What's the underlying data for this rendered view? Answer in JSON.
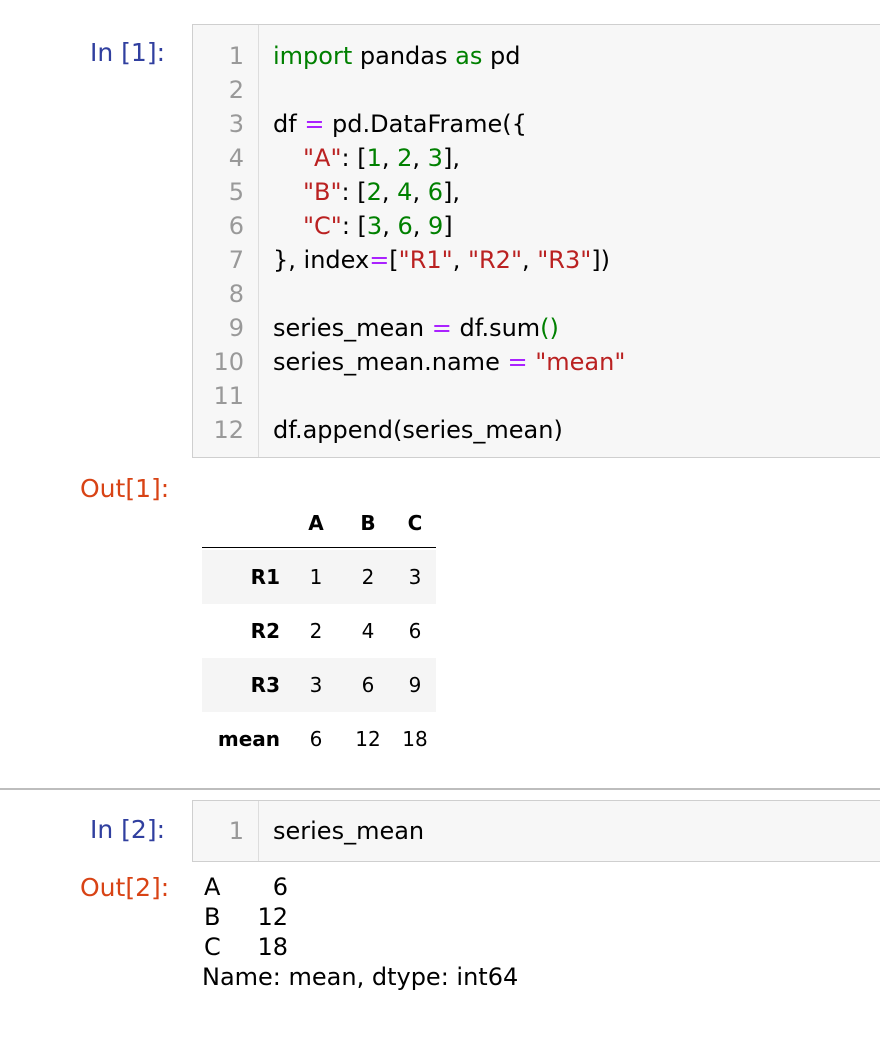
{
  "cells": [
    {
      "in_prompt": "In [1]:",
      "out_prompt": "Out[1]:",
      "line_numbers": [
        "1",
        "2",
        "3",
        "4",
        "5",
        "6",
        "7",
        "8",
        "9",
        "10",
        "11",
        "12"
      ],
      "code": {
        "l1": {
          "kw": "import",
          "a": " pandas ",
          "kw2": "as",
          "b": " pd"
        },
        "l3": {
          "a": "df ",
          "op": "=",
          "b": " pd.DataFrame({"
        },
        "l4": {
          "s": "\"A\"",
          "a": ": [",
          "n1": "1",
          "c1": ", ",
          "n2": "2",
          "c2": ", ",
          "n3": "3",
          "b": "],"
        },
        "l5": {
          "s": "\"B\"",
          "a": ": [",
          "n1": "2",
          "c1": ", ",
          "n2": "4",
          "c2": ", ",
          "n3": "6",
          "b": "],"
        },
        "l6": {
          "s": "\"C\"",
          "a": ": [",
          "n1": "3",
          "c1": ", ",
          "n2": "6",
          "c2": ", ",
          "n3": "9",
          "b": "]"
        },
        "l7": {
          "a": "}, index",
          "op": "=",
          "b": "[",
          "s1": "\"R1\"",
          "c1": ", ",
          "s2": "\"R2\"",
          "c2": ", ",
          "s3": "\"R3\"",
          "c": "])"
        },
        "l9": {
          "a": "series_mean ",
          "op": "=",
          "b": " df.sum",
          "op2": "()"
        },
        "l10": {
          "a": "series_mean.name ",
          "op": "=",
          "b": " ",
          "s": "\"mean\""
        },
        "l12": {
          "a": "df.append(series_mean)"
        }
      },
      "output_table": {
        "columns": [
          "A",
          "B",
          "C"
        ],
        "rows": [
          {
            "index": "R1",
            "values": [
              "1",
              "2",
              "3"
            ]
          },
          {
            "index": "R2",
            "values": [
              "2",
              "4",
              "6"
            ]
          },
          {
            "index": "R3",
            "values": [
              "3",
              "6",
              "9"
            ]
          },
          {
            "index": "mean",
            "values": [
              "6",
              "12",
              "18"
            ]
          }
        ]
      }
    },
    {
      "in_prompt": "In [2]:",
      "out_prompt": "Out[2]:",
      "line_numbers": [
        "1"
      ],
      "code": {
        "l1": "series_mean"
      },
      "output_series": {
        "entries": [
          {
            "key": "A",
            "value": "6"
          },
          {
            "key": "B",
            "value": "12"
          },
          {
            "key": "C",
            "value": "18"
          }
        ],
        "footer": "Name: mean, dtype: int64"
      }
    }
  ],
  "colors": {
    "in_prompt": "#303f9f",
    "out_prompt": "#d84315",
    "keyword": "#008000",
    "operator": "#aa22ff",
    "string": "#ba2121",
    "number": "#008000"
  }
}
